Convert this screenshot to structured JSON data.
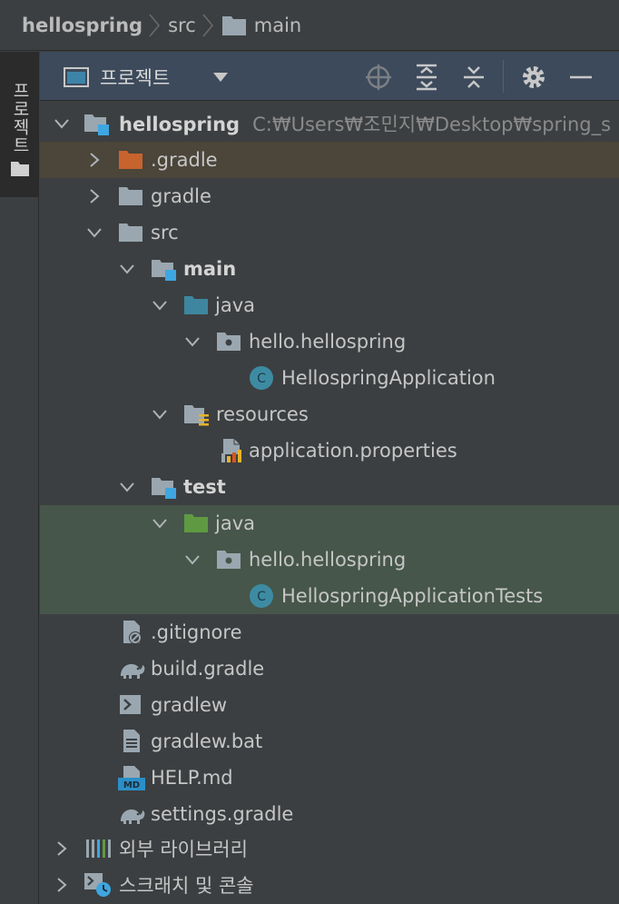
{
  "breadcrumb": {
    "project": "hellospring",
    "src": "src",
    "main": "main"
  },
  "tool_strip": {
    "project_tab": "프로젝트"
  },
  "header": {
    "title": "프로젝트",
    "buttons": [
      "locate-icon",
      "expand-all-icon",
      "collapse-all-icon",
      "gear-icon",
      "minimize-icon"
    ]
  },
  "tree": {
    "root_name": "hellospring",
    "root_path": "C:₩Users₩조민지₩Desktop₩spring_s",
    "gradle_dot": ".gradle",
    "gradle": "gradle",
    "src": "src",
    "main": "main",
    "main_java": "java",
    "main_pkg": "hello.hellospring",
    "main_class": "HellospringApplication",
    "resources": "resources",
    "app_props": "application.properties",
    "test": "test",
    "test_java": "java",
    "test_pkg": "hello.hellospring",
    "test_class": "HellospringApplicationTests",
    "gitignore": ".gitignore",
    "build_gradle": "build.gradle",
    "gradlew": "gradlew",
    "gradlew_bat": "gradlew.bat",
    "help_md": "HELP.md",
    "settings_gradle": "settings.gradle",
    "ext_libs": "외부 라이브러리",
    "scratches": "스크래치 및 콘솔"
  },
  "colors": {
    "background": "#3c3f41",
    "header": "#3d4a5c",
    "selection_brown": "#4b453a",
    "selection_green": "#46564a",
    "java_folder": "#3e86a0",
    "test_folder": "#5f9a43",
    "excluded_folder": "#c7632d",
    "class_icon": "#3d8ba3"
  }
}
